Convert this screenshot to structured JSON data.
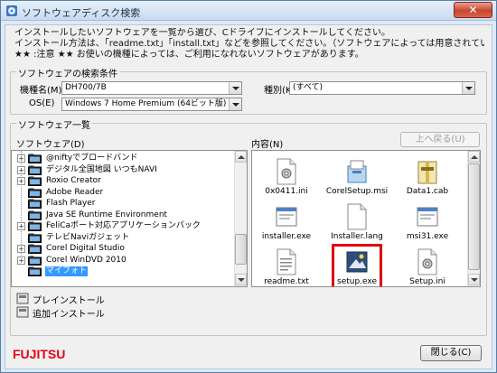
{
  "window": {
    "title": "ソフトウェアディスク検索",
    "close_glyph": "✕"
  },
  "intro": [
    "インストールしたいソフトウェアを一覧から選び、Cドライブにインストールしてください。",
    "インストール方法は、「readme.txt」「install.txt」などを参照してください。（ソフトウェアによっては用意されていない場合もあります）",
    "★★ :注意 ★★ お使いの機種によっては、ご利用になれないソフトウェアがあります。"
  ],
  "search": {
    "group_title": "ソフトウェアの検索条件",
    "model_label": "機種名(M)",
    "model_value": "DH700/7B",
    "category_label": "種別(K)",
    "category_value": "(すべて)",
    "os_label": "OS(E)",
    "os_value": "Windows 7 Home Premium (64ビット版)"
  },
  "list": {
    "group_title": "ソフトウェア一覧",
    "software_label": "ソフトウェア(D)",
    "content_label": "内容(N)",
    "up_button": "上へ戻る(U)",
    "tree": [
      {
        "label": "@niftyでブロードバンド",
        "expander": "+"
      },
      {
        "label": "デジタル全国地図 いつもNAVI",
        "expander": "+"
      },
      {
        "label": "Roxio Creator",
        "expander": "+"
      },
      {
        "label": "Adobe Reader",
        "expander": ""
      },
      {
        "label": "Flash Player",
        "expander": ""
      },
      {
        "label": "Java SE Runtime Environment",
        "expander": ""
      },
      {
        "label": "FeliCaポート対応アプリケーションパック",
        "expander": "+"
      },
      {
        "label": "テレビNaviガジェット",
        "expander": ""
      },
      {
        "label": "Corel Digital Studio",
        "expander": "+"
      },
      {
        "label": "Corel WinDVD 2010",
        "expander": "+"
      },
      {
        "label": "マイフォト",
        "expander": "",
        "selected": true
      }
    ],
    "files": [
      {
        "name": "0x0411.ini",
        "icon": "ini-file-icon"
      },
      {
        "name": "CorelSetup.msi",
        "icon": "msi-installer-icon"
      },
      {
        "name": "Data1.cab",
        "icon": "cab-archive-icon"
      },
      {
        "name": "installer.exe",
        "icon": "exe-file-icon"
      },
      {
        "name": "Installer.lang",
        "icon": "blank-file-icon"
      },
      {
        "name": "msi31.exe",
        "icon": "exe-file-icon"
      },
      {
        "name": "readme.txt",
        "icon": "text-file-icon"
      },
      {
        "name": "setup.exe",
        "icon": "setup-exe-icon",
        "highlighted": true,
        "highlight_color": "#e00000"
      },
      {
        "name": "Setup.ini",
        "icon": "ini-file-icon"
      }
    ]
  },
  "install": {
    "items": [
      {
        "label": "プレインストール",
        "icon": "install-disk-icon"
      },
      {
        "label": "追加インストール",
        "icon": "install-disk-icon"
      }
    ]
  },
  "footer": {
    "logo_text": "FUJITSU",
    "logo_color": "#e60012",
    "close_button": "閉じる(C)"
  },
  "colors": {
    "selection": "#3399ff",
    "window_border": "#5a7ea6"
  }
}
